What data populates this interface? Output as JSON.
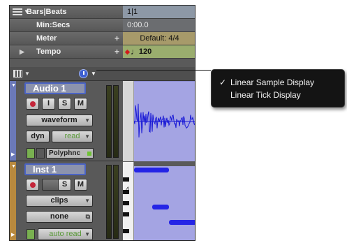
{
  "rulers": [
    {
      "label": "Bars|Beats",
      "value": "1|1"
    },
    {
      "label": "Min:Secs",
      "value": "0:00.0"
    },
    {
      "label": "Meter",
      "value": "Default: 4/4"
    },
    {
      "label": "Tempo",
      "value": "120"
    }
  ],
  "tracks": {
    "audio": {
      "name": "Audio 1",
      "solo": "S",
      "mute": "M",
      "input": "I",
      "view": "waveform",
      "automation": "dyn",
      "automation_mode": "read",
      "plugin": "Polyphnc"
    },
    "inst": {
      "name": "Inst 1",
      "solo": "S",
      "mute": "M",
      "view": "clips",
      "automation": "none",
      "automation_mode": "auto read",
      "piano_label": "4"
    }
  },
  "timebase_menu": {
    "items": [
      {
        "label": "Linear Sample Display",
        "checked": true
      },
      {
        "label": "Linear Tick Display",
        "checked": false
      }
    ],
    "check_glyph": "✓"
  },
  "colors": {
    "audio_track": "#6b79b8",
    "inst_track": "#b8893e",
    "playlist": "#a4a4e3",
    "midi_note": "#2424e6",
    "waveform": "#1818d6"
  }
}
